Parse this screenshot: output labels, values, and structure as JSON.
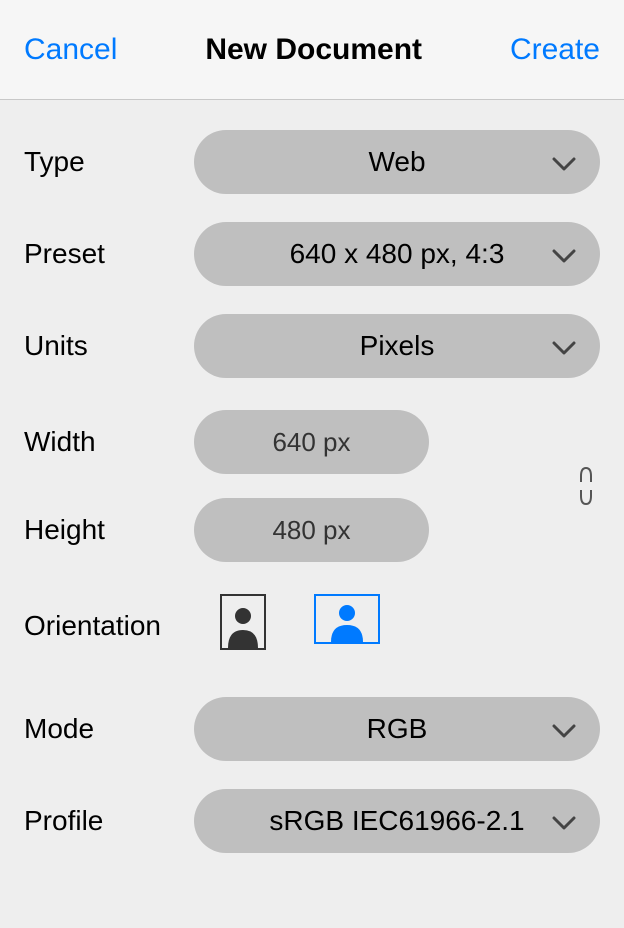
{
  "header": {
    "cancel": "Cancel",
    "title": "New Document",
    "create": "Create"
  },
  "form": {
    "type": {
      "label": "Type",
      "value": "Web"
    },
    "preset": {
      "label": "Preset",
      "value": "640 x 480 px, 4:3"
    },
    "units": {
      "label": "Units",
      "value": "Pixels"
    },
    "width": {
      "label": "Width",
      "value": "640 px"
    },
    "height": {
      "label": "Height",
      "value": "480 px"
    },
    "orientation": {
      "label": "Orientation",
      "selected": "landscape"
    },
    "mode": {
      "label": "Mode",
      "value": "RGB"
    },
    "profile": {
      "label": "Profile",
      "value": "sRGB IEC61966-2.1"
    }
  },
  "colors": {
    "accent": "#007aff",
    "pill": "#bfbfbf"
  }
}
